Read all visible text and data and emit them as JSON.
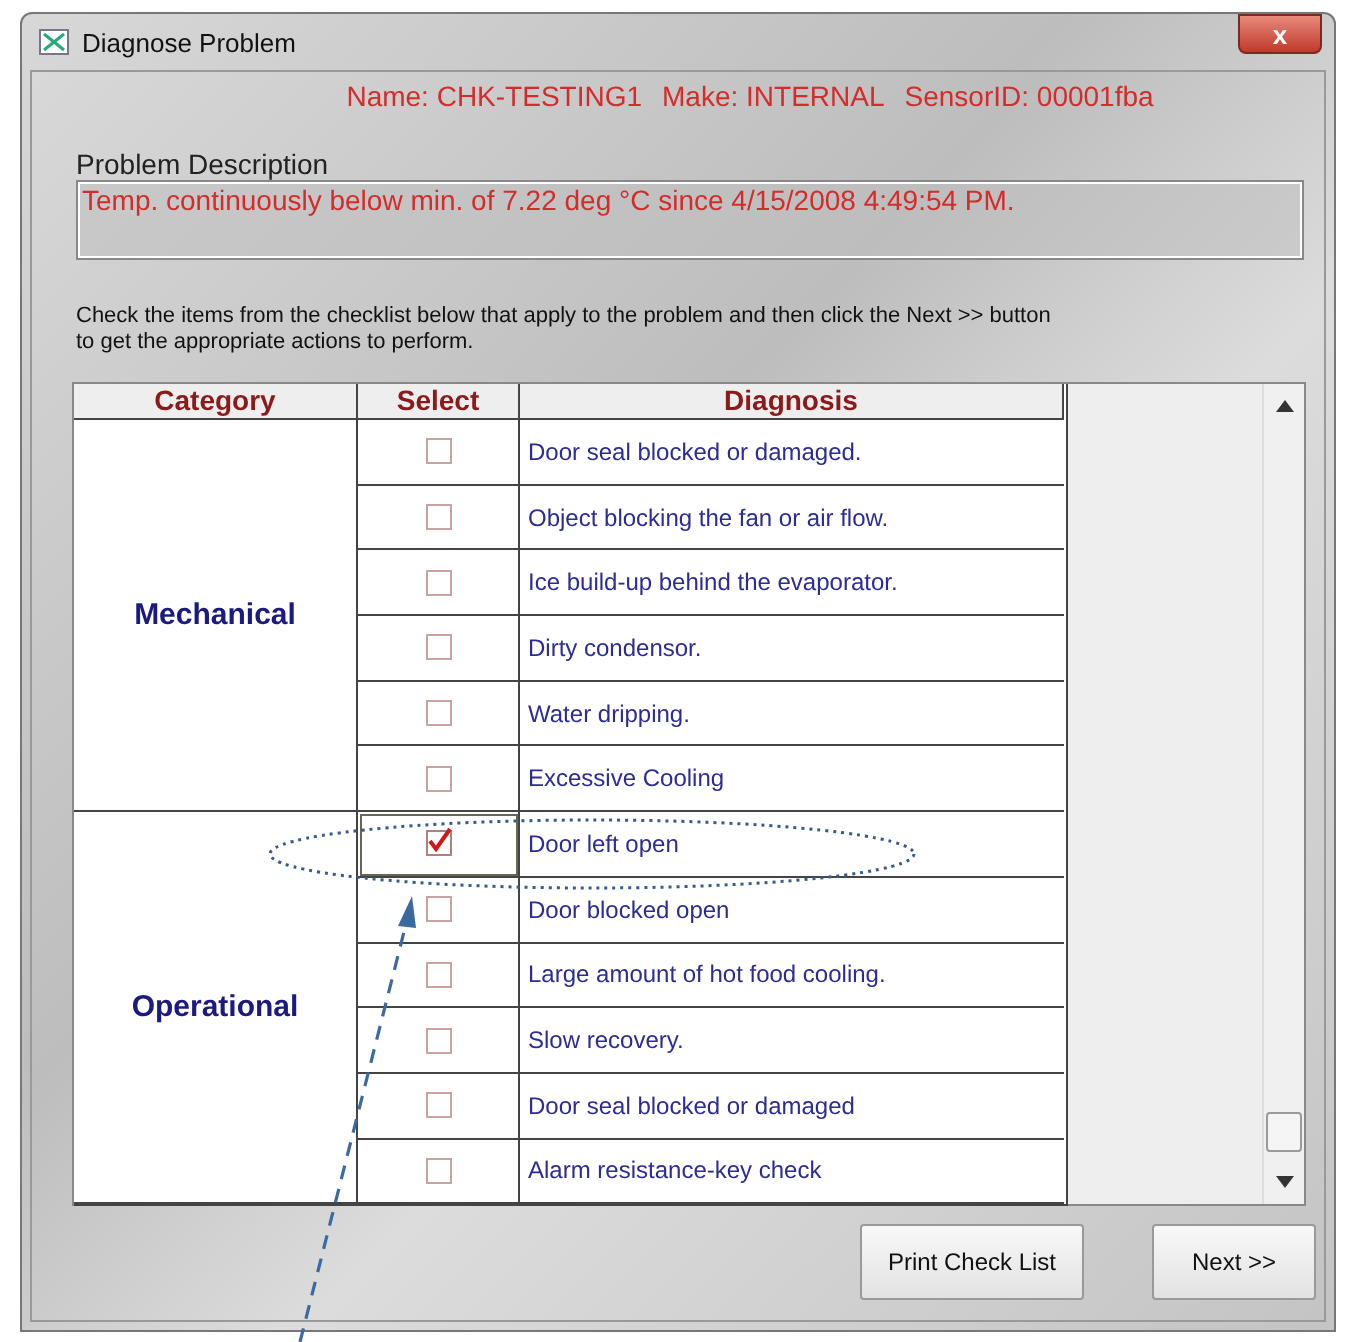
{
  "window": {
    "title": "Diagnose Problem",
    "close": "x"
  },
  "sensor_info": [
    "Name: CHK-TESTING1",
    "Make: INTERNAL",
    "SensorID: 00001fba"
  ],
  "problem_description": {
    "label": "Problem Description",
    "value": "Temp. continuously below min. of 7.22 deg °C since 4/15/2008 4:49:54 PM."
  },
  "instructions": "Check the items from the checklist below that apply to the problem and then click the Next >> button to get the appropriate actions to perform.",
  "table": {
    "columns": [
      "Category",
      "Select",
      "Diagnosis"
    ],
    "groups": [
      {
        "category": "Mechanical",
        "items": [
          {
            "diagnosis": "Door seal blocked or damaged.",
            "checked": false
          },
          {
            "diagnosis": "Object blocking the fan or air flow.",
            "checked": false
          },
          {
            "diagnosis": "Ice build-up behind the evaporator.",
            "checked": false
          },
          {
            "diagnosis": "Dirty condensor.",
            "checked": false
          },
          {
            "diagnosis": "Water dripping.",
            "checked": false
          },
          {
            "diagnosis": "Excessive Cooling",
            "checked": false
          }
        ]
      },
      {
        "category": "Operational",
        "items": [
          {
            "diagnosis": "Door left open",
            "checked": true
          },
          {
            "diagnosis": "Door blocked open",
            "checked": false
          },
          {
            "diagnosis": "Large amount of hot food cooling.",
            "checked": false
          },
          {
            "diagnosis": "Slow recovery.",
            "checked": false
          },
          {
            "diagnosis": "Door seal blocked or damaged",
            "checked": false
          },
          {
            "diagnosis": "Alarm resistance-key check",
            "checked": false
          }
        ]
      }
    ]
  },
  "buttons": [
    "Print Check List",
    "Next >>"
  ]
}
